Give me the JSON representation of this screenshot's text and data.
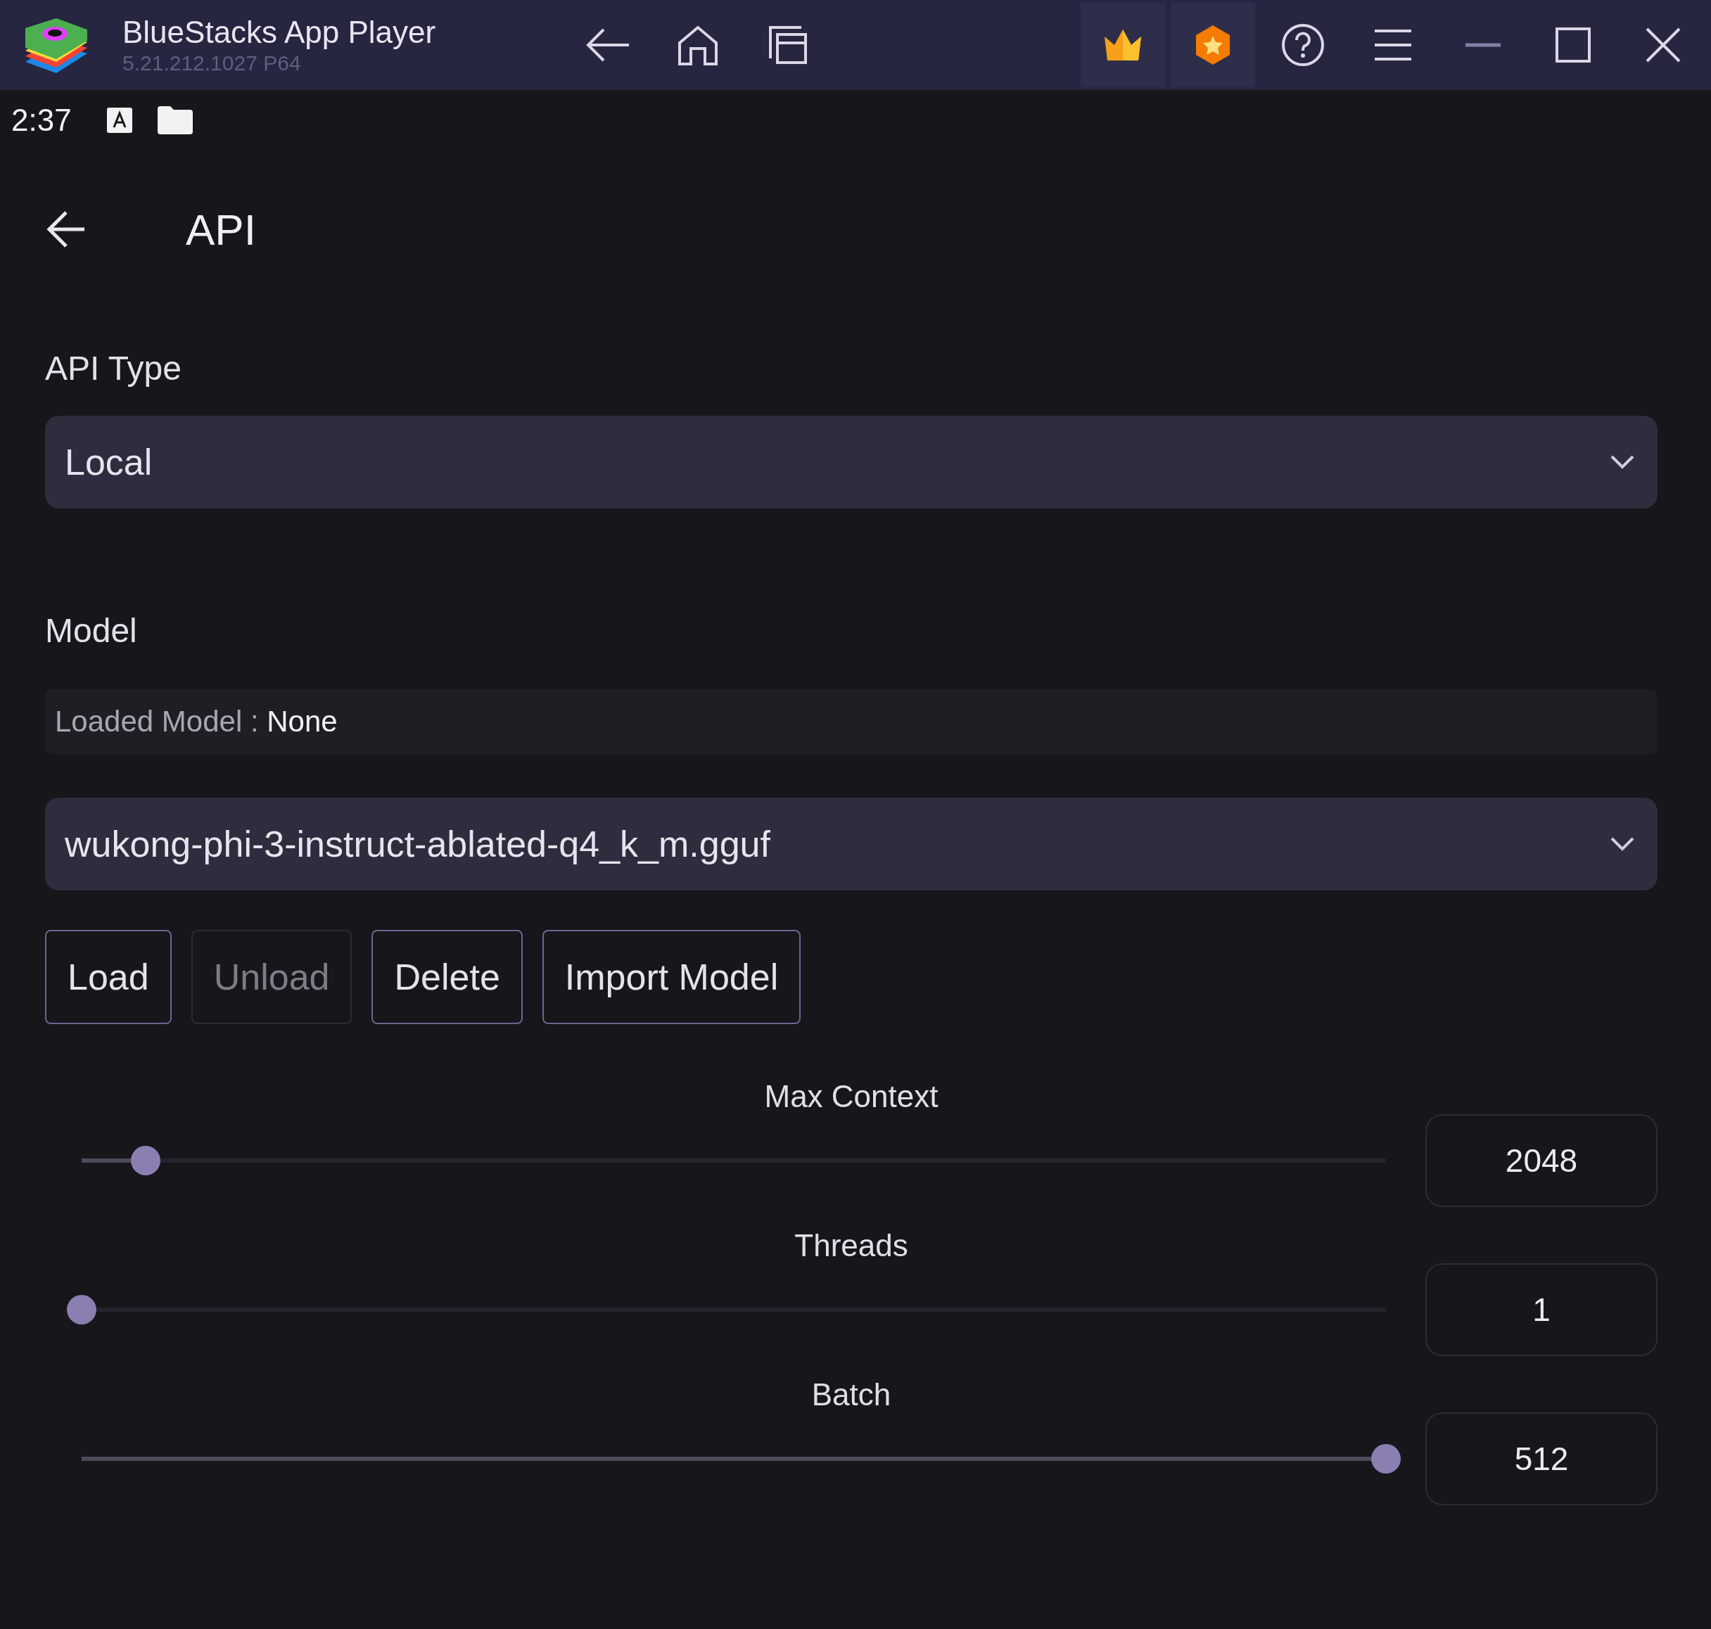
{
  "window": {
    "title": "BlueStacks App Player",
    "version": "5.21.212.1027  P64"
  },
  "status_bar": {
    "time": "2:37"
  },
  "header": {
    "title": "API"
  },
  "api_type": {
    "label": "API Type",
    "value": "Local"
  },
  "model": {
    "label": "Model",
    "loaded_label": "Loaded Model : ",
    "loaded_value": "None",
    "value": "wukong-phi-3-instruct-ablated-q4_k_m.gguf"
  },
  "buttons": [
    {
      "label": "Load",
      "disabled": false
    },
    {
      "label": "Unload",
      "disabled": true
    },
    {
      "label": "Delete",
      "disabled": false
    },
    {
      "label": "Import Model",
      "disabled": false
    }
  ],
  "sliders": [
    {
      "label": "Max Context",
      "level": 0.049,
      "value": "2048"
    },
    {
      "label": "Threads",
      "level": 0,
      "value": "1"
    },
    {
      "label": "Batch",
      "level": 1,
      "value": "512"
    }
  ]
}
